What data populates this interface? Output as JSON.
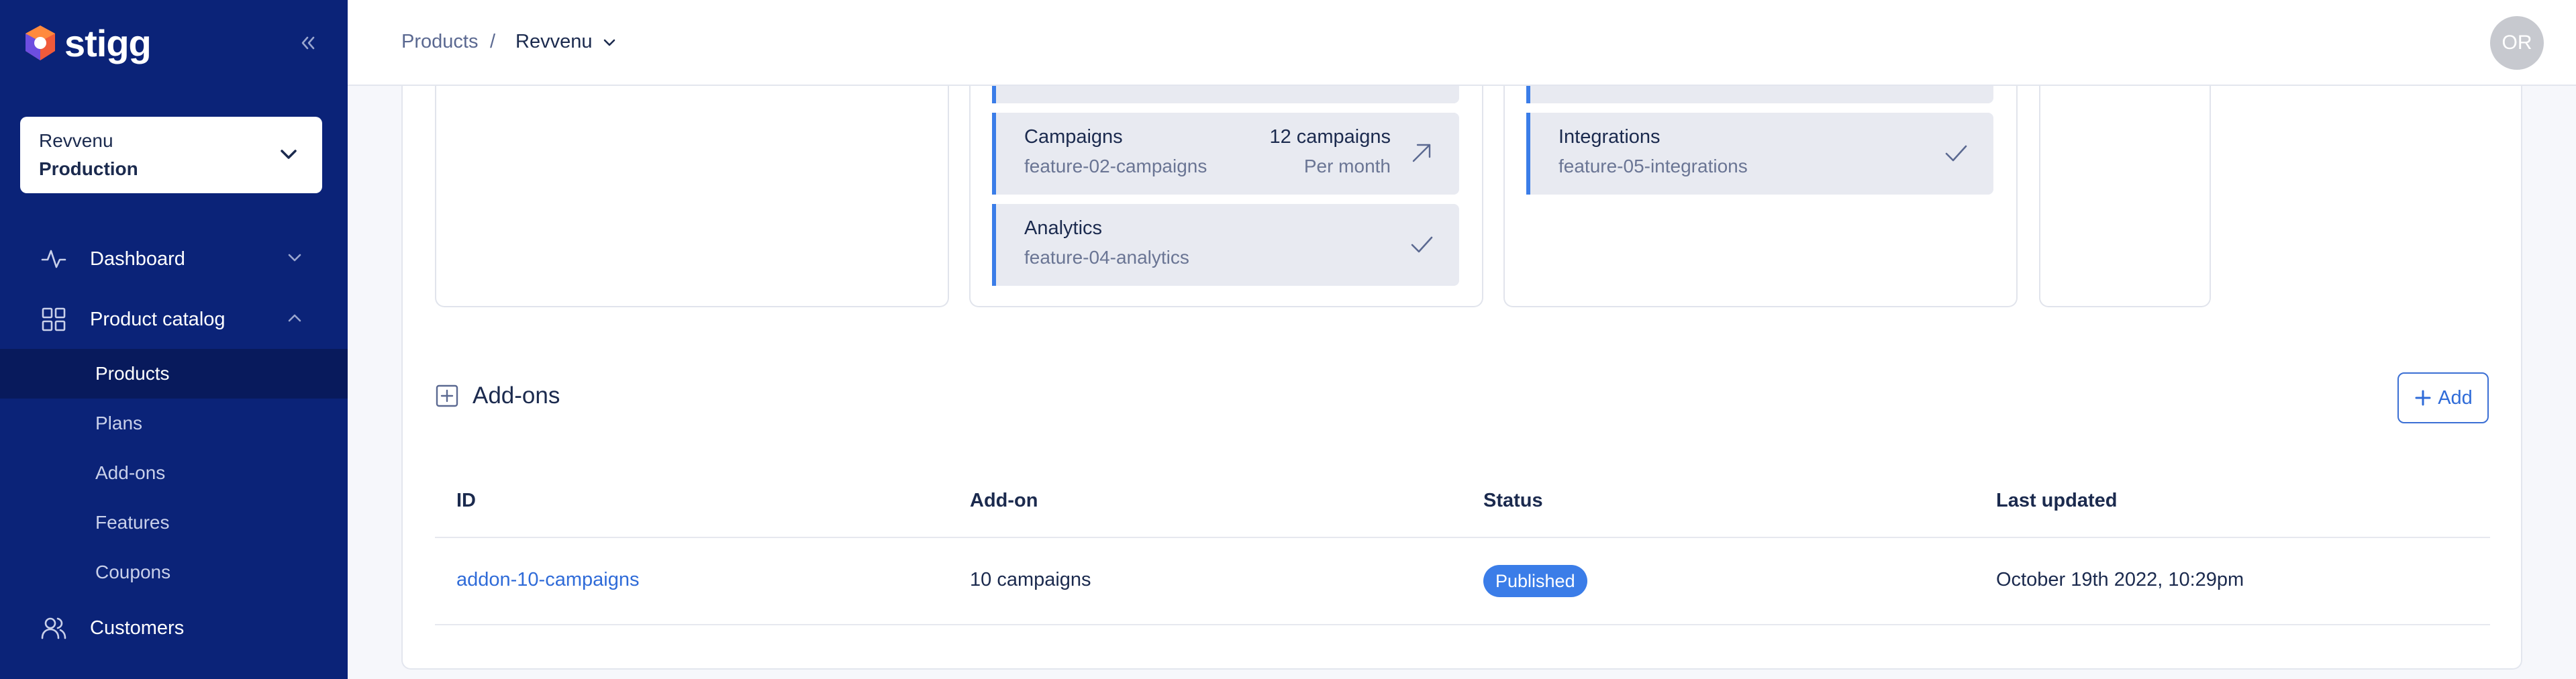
{
  "brand": {
    "name": "stigg"
  },
  "environment": {
    "product": "Revvenu",
    "name": "Production"
  },
  "nav": {
    "dashboard": "Dashboard",
    "product_catalog": "Product catalog",
    "sub_items": [
      "Products",
      "Plans",
      "Add-ons",
      "Features",
      "Coupons"
    ],
    "customers": "Customers"
  },
  "breadcrumb": {
    "root": "Products",
    "separator": "/",
    "current": "Revvenu"
  },
  "user": {
    "initials": "OR"
  },
  "plans": {
    "col2_features": [
      {
        "name": "Campaigns",
        "slug": "feature-02-campaigns",
        "qty": "12 campaigns",
        "period": "Per month",
        "icon": "arrow-up-right-icon"
      },
      {
        "name": "Analytics",
        "slug": "feature-04-analytics",
        "icon": "check-icon"
      }
    ],
    "col3_features": [
      {
        "name": "Integrations",
        "slug": "feature-05-integrations",
        "icon": "check-icon"
      }
    ]
  },
  "addons": {
    "title": "Add-ons",
    "add_label": "Add",
    "columns": [
      "ID",
      "Add-on",
      "Status",
      "Last updated"
    ],
    "rows": [
      {
        "id": "addon-10-campaigns",
        "name": "10 campaigns",
        "status": "Published",
        "updated": "October 19th 2022, 10:29pm"
      }
    ]
  },
  "colors": {
    "sidebar": "#0b2378",
    "accent": "#3b7de8",
    "link": "#2f6bd8"
  }
}
